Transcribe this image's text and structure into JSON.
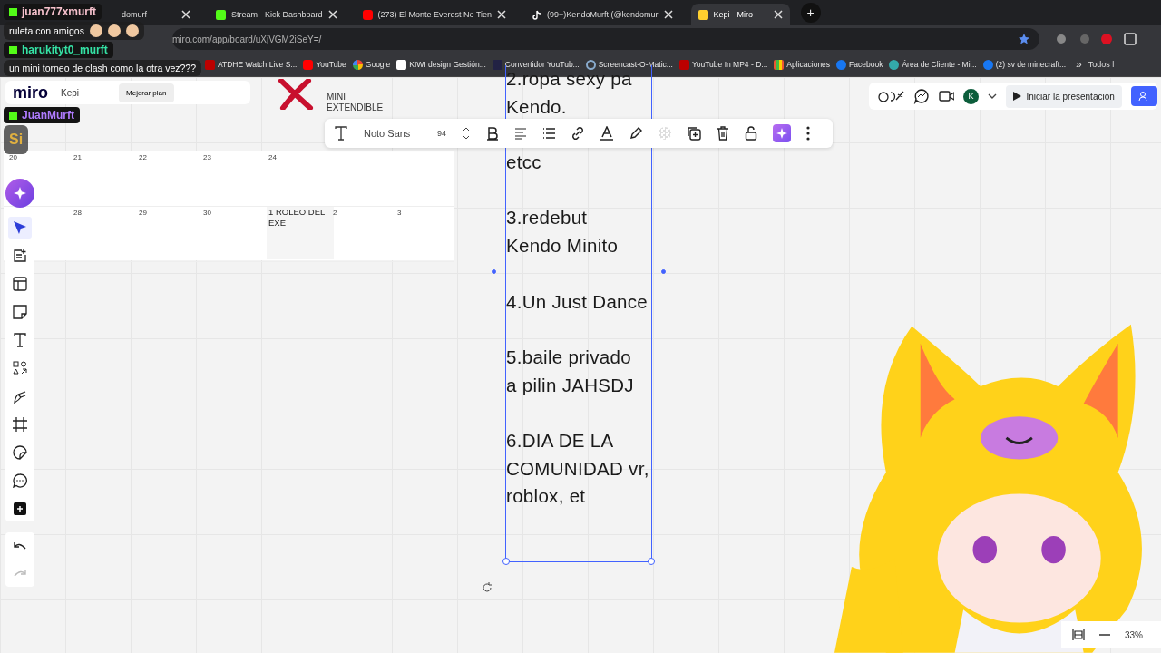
{
  "browser": {
    "tabs": [
      {
        "title": "domurf",
        "selected": false
      },
      {
        "title": "Stream - Kick Dashboard",
        "selected": false
      },
      {
        "title": "(273) El Monte Everest No Tien",
        "selected": false
      },
      {
        "title": "(99+)KendoMurft (@kendomur",
        "selected": false
      },
      {
        "title": "Kepi - Miro",
        "selected": true
      }
    ],
    "new_tab": "+",
    "address": "miro.com/app/board/uXjVGM2iSeY=/",
    "bookmarks": [
      {
        "label": "ATDHE Watch Live S..."
      },
      {
        "label": "YouTube"
      },
      {
        "label": "Google"
      },
      {
        "label": "KIWI design Gestión..."
      },
      {
        "label": "Convertidor YouTub..."
      },
      {
        "label": "Screencast-O-Matic..."
      },
      {
        "label": "YouTube In MP4 - D..."
      },
      {
        "label": "Aplicaciones"
      },
      {
        "label": "Facebook"
      },
      {
        "label": "Área de Cliente - Mi..."
      },
      {
        "label": "(2) sv de minecraft..."
      }
    ],
    "more": "»",
    "all_bookmarks": "Todos l"
  },
  "miro": {
    "logo": "miro",
    "board_name": "Kepi",
    "upgrade": "Mejorar plan",
    "canvas": {
      "mark_label": "MINI EXTENDIBLE",
      "calendar": [
        [
          "20",
          "21",
          "22",
          "23",
          "24"
        ],
        [
          "28",
          "29",
          "30",
          "1 ROLEO DEL EXE",
          "2",
          "3"
        ]
      ],
      "text_box": {
        "paragraphs": [
          [
            "2.ropa sexy pa",
            "Kendo."
          ],
          [
            "etcc"
          ],
          [
            "3.redebut",
            "Kendo Minito"
          ],
          [
            "4.Un Just Dance"
          ],
          [
            "5.baile privado",
            "a pilin JAHSDJ"
          ],
          [
            "6.DIA DE LA",
            "COMUNIDAD vr,",
            "roblox, et"
          ]
        ],
        "selected": true
      }
    },
    "text_toolbar": {
      "font": "Noto Sans",
      "size": "94"
    },
    "top_right": {
      "avatar": "K",
      "present": "Iniciar la presentación"
    },
    "tools": [
      {
        "kind": "select",
        "selected": true
      },
      {
        "kind": "template",
        "selected": false
      },
      {
        "kind": "layout",
        "selected": false
      },
      {
        "kind": "sticky",
        "selected": false
      },
      {
        "kind": "text",
        "selected": false
      },
      {
        "kind": "shapes",
        "selected": false
      },
      {
        "kind": "pen",
        "selected": false
      },
      {
        "kind": "frame",
        "selected": false
      },
      {
        "kind": "sticker",
        "selected": false
      },
      {
        "kind": "comment",
        "selected": false
      },
      {
        "kind": "plus",
        "selected": false
      }
    ],
    "zoom": "33%"
  },
  "chat": [
    {
      "user": "juan777xmurft",
      "color": "#f6c1cc",
      "text": "ruleta con amigos"
    },
    {
      "user": "harukityt0_murft",
      "color": "#35e3a6",
      "text": "un mini torneo de clash como la otra vez???"
    },
    {
      "user": "JuanMurft",
      "color": "#b07cff",
      "text": "Si"
    }
  ]
}
